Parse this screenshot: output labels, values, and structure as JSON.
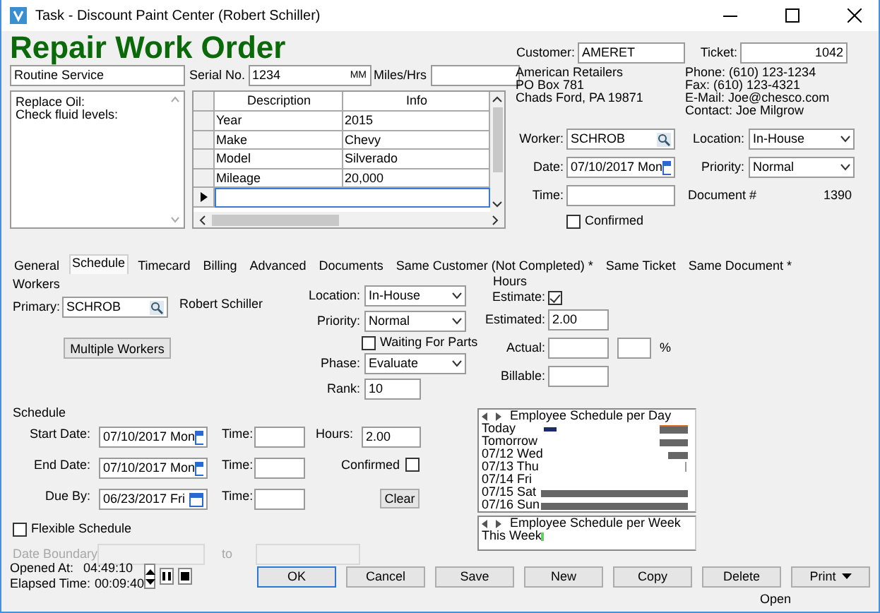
{
  "window": {
    "title": "Task - Discount Paint Center (Robert Schiller)"
  },
  "heading": "Repair Work Order",
  "summary": {
    "value": "Routine Service"
  },
  "serial": {
    "label": "Serial No.",
    "value": "1234",
    "unit": "MM"
  },
  "miles": {
    "label": "Miles/Hrs"
  },
  "notes": "Replace Oil:\nCheck fluid levels:",
  "vehicle_grid": {
    "columns": [
      "Description",
      "Info"
    ],
    "rows": [
      {
        "description": "Year",
        "info": "2015"
      },
      {
        "description": "Make",
        "info": "Chevy"
      },
      {
        "description": "Model",
        "info": "Silverado"
      },
      {
        "description": "Mileage",
        "info": "20,000"
      }
    ]
  },
  "customer": {
    "label": "Customer:",
    "value": "AMERET"
  },
  "ticket": {
    "label": "Ticket:",
    "value": "1042"
  },
  "address": [
    "American Retailers",
    "PO Box 781",
    "Chads Ford, PA 19871"
  ],
  "contact": [
    "Phone: (610) 123-1234",
    "Fax: (610) 123-4321",
    "E-Mail: Joe@chesco.com",
    "Contact: Joe Milgrow"
  ],
  "worker": {
    "label": "Worker:",
    "value": "SCHROB"
  },
  "date": {
    "label": "Date:",
    "value": "07/10/2017 Mon"
  },
  "time": {
    "label": "Time:"
  },
  "confirmed": {
    "label": "Confirmed",
    "checked": false
  },
  "location": {
    "label": "Location:",
    "value": "In-House"
  },
  "priority": {
    "label": "Priority:",
    "value": "Normal"
  },
  "document": {
    "label": "Document #",
    "value": "1390"
  },
  "tabs": [
    {
      "label": "General",
      "selected": false
    },
    {
      "label": "Schedule",
      "selected": true
    },
    {
      "label": "Timecard",
      "selected": false
    },
    {
      "label": "Billing",
      "selected": false
    },
    {
      "label": "Advanced",
      "selected": false
    },
    {
      "label": "Documents",
      "selected": false
    },
    {
      "label": "Same Customer (Not Completed) *",
      "selected": false
    },
    {
      "label": "Same Ticket",
      "selected": false
    },
    {
      "label": "Same Document *",
      "selected": false
    }
  ],
  "schedule_tab": {
    "workers": {
      "heading": "Workers",
      "label": "Primary:",
      "value": "SCHROB",
      "name": "Robert Schiller",
      "button": "Multiple Workers"
    },
    "location": {
      "label": "Location:",
      "value": "In-House"
    },
    "priority": {
      "label": "Priority:",
      "value": "Normal"
    },
    "waiting_for_parts": {
      "label": "Waiting For Parts",
      "checked": false
    },
    "phase": {
      "label": "Phase:",
      "value": "Evaluate"
    },
    "rank": {
      "label": "Rank:",
      "value": "10"
    },
    "hours": {
      "heading": "Hours",
      "estimate_label": "Estimate:",
      "estimate_checked": true,
      "estimated_label": "Estimated:",
      "estimated_value": "2.00",
      "actual_label": "Actual:",
      "percent": "%",
      "billable_label": "Billable:"
    },
    "schedule": {
      "heading": "Schedule",
      "rows": [
        {
          "label": "Start Date:",
          "date": "07/10/2017 Mon",
          "time_label": "Time:"
        },
        {
          "label": "End Date:",
          "date": "07/10/2017 Mon",
          "time_label": "Time:"
        },
        {
          "label": "Due By:",
          "date": "06/23/2017 Fri",
          "time_label": "Time:"
        }
      ],
      "hours_label": "Hours:",
      "hours_value": "2.00",
      "confirmed_label": "Confirmed",
      "confirmed_checked": false,
      "clear_button": "Clear",
      "flexible": {
        "label": "Flexible Schedule",
        "checked": false
      },
      "date_boundary": {
        "label": "Date Boundary",
        "to": "to",
        "disabled": true
      }
    },
    "day_chart": {
      "title": "Employee Schedule per Day",
      "rows": [
        "Today",
        "Tomorrow",
        "07/12 Wed",
        "07/13 Thu",
        "07/14 Fri",
        "07/15 Sat",
        "07/16 Sun"
      ]
    },
    "week_chart": {
      "title": "Employee Schedule per Week",
      "rows": [
        "This Week"
      ]
    }
  },
  "footer": {
    "opened_label": "Opened At:",
    "opened_value": "04:49:10",
    "elapsed_label": "Elapsed Time:",
    "elapsed_value": "00:09:40",
    "buttons": [
      {
        "label": "OK",
        "kind": "default"
      },
      {
        "label": "Cancel",
        "kind": "plain"
      },
      {
        "label": "Save",
        "kind": "plain"
      },
      {
        "label": "New",
        "kind": "plain"
      },
      {
        "label": "Copy",
        "kind": "plain"
      },
      {
        "label": "Delete",
        "kind": "plain"
      },
      {
        "label": "Print",
        "kind": "menu"
      }
    ],
    "status": "Open"
  }
}
